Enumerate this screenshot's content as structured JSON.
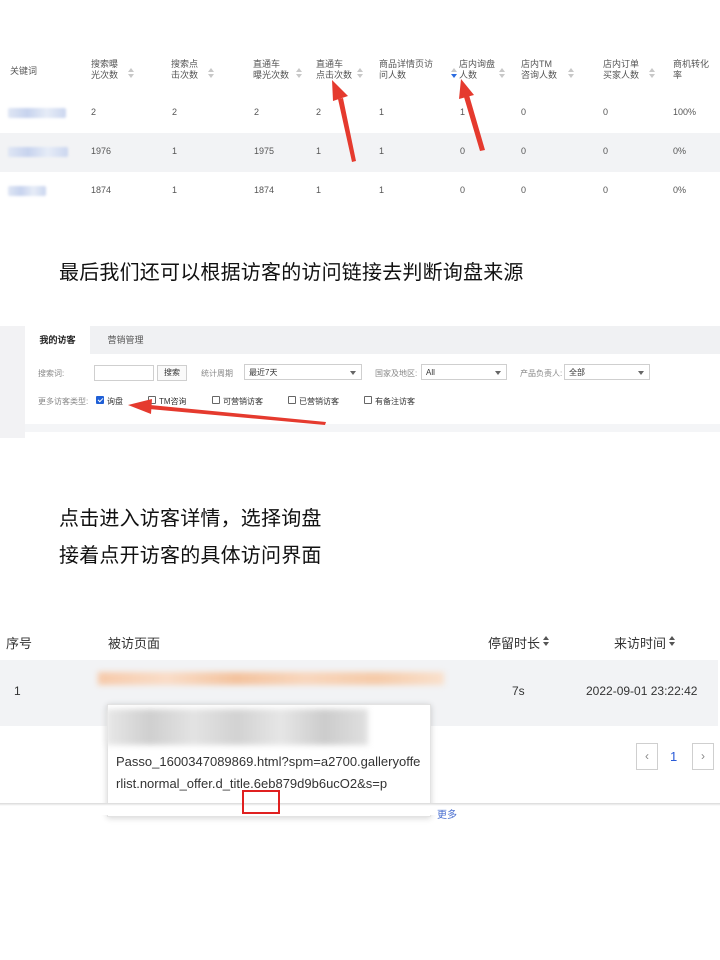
{
  "keyword_table": {
    "headers": [
      {
        "line1": "关键词",
        "line2": ""
      },
      {
        "line1": "搜索曝",
        "line2": "光次数"
      },
      {
        "line1": "搜索点",
        "line2": "击次数"
      },
      {
        "line1": "直通车",
        "line2": "曝光次数"
      },
      {
        "line1": "直通车",
        "line2": "点击次数"
      },
      {
        "line1": "商品详情页访",
        "line2": "问人数"
      },
      {
        "line1": "店内询盘",
        "line2": "人数"
      },
      {
        "line1": "店内TM",
        "line2": "咨询人数"
      },
      {
        "line1": "店内订单",
        "line2": "买家人数"
      },
      {
        "line1": "商机转化",
        "line2": "率"
      }
    ],
    "rows": [
      [
        "2",
        "2",
        "2",
        "2",
        "1",
        "1",
        "0",
        "0",
        "100%"
      ],
      [
        "1976",
        "1",
        "1975",
        "1",
        "1",
        "0",
        "0",
        "0",
        "0%"
      ],
      [
        "1874",
        "1",
        "1874",
        "1",
        "1",
        "0",
        "0",
        "0",
        "0%"
      ]
    ]
  },
  "captions": {
    "c1": "最后我们还可以根据访客的访问链接去判断询盘来源",
    "c2": "点击进入访客详情，选择询盘",
    "c3": "接着点开访客的具体访问界面"
  },
  "visitor_panel": {
    "tabs": [
      "我的访客",
      "营销管理"
    ],
    "search_label": "搜索词:",
    "search_button": "搜索",
    "period_label": "统计周期",
    "period_value": "最近7天",
    "region_label": "国家及地区:",
    "region_value": "All",
    "owner_label": "产品负责人:",
    "owner_value": "全部",
    "types_label": "更多访客类型:",
    "checkboxes": [
      {
        "label": "询盘",
        "checked": true
      },
      {
        "label": "TM咨询",
        "checked": false
      },
      {
        "label": "可营销访客",
        "checked": false
      },
      {
        "label": "已营销访客",
        "checked": false
      },
      {
        "label": "有备注访客",
        "checked": false
      }
    ]
  },
  "visit_table": {
    "headers": {
      "index": "序号",
      "page": "被访页面",
      "stay": "停留时长",
      "time": "来访时间"
    },
    "rows": [
      {
        "index": "1",
        "stay": "7s",
        "time": "2022-09-01 23:22:42"
      }
    ],
    "popup_url": "Passo_1600347089869.html?spm=a2700.galleryofferlist.normal_offer.d_title.6eb879d9b6ucO2&s=p",
    "page_current": "1",
    "more_link": "更多"
  },
  "colors": {
    "accent": "#2a5bd7",
    "highlight_red": "#e02020",
    "arrow_red": "#e53a2e"
  }
}
